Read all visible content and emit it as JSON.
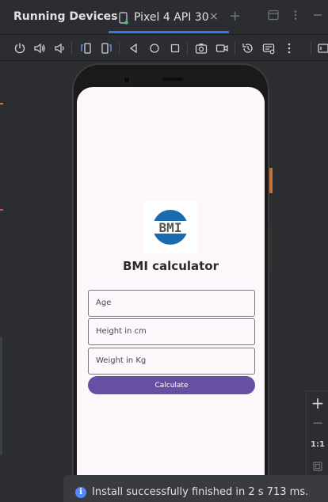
{
  "panel": {
    "title": "Running Devices"
  },
  "tabs": [
    {
      "label": "Pixel 4 API 30",
      "close": "×"
    }
  ],
  "tab_add": "+",
  "toolbar": {
    "icons": [
      "power-icon",
      "volume-up-icon",
      "volume-down-icon",
      "rotate-left-icon",
      "rotate-right-icon",
      "back-icon",
      "home-icon",
      "overview-icon",
      "screenshot-icon",
      "screen-record-icon",
      "reset-icon",
      "controls-icon",
      "more-icon"
    ]
  },
  "app": {
    "title": "BMI calculator",
    "logo_text": "BMI",
    "fields": {
      "age": "Age",
      "height": "Height in cm",
      "weight": "Weight in Kg"
    },
    "calculate_label": "Calculate"
  },
  "zoom": {
    "in": "+",
    "out": "−",
    "actual": "1:1"
  },
  "notification": {
    "message": "Install successfully finished in 2 s 713 ms.",
    "icon": "i"
  },
  "colors": {
    "accent": "#3574f0",
    "button": "#6750a4",
    "screen": "#fdf7fc",
    "ide_bg": "#2b2d30"
  }
}
